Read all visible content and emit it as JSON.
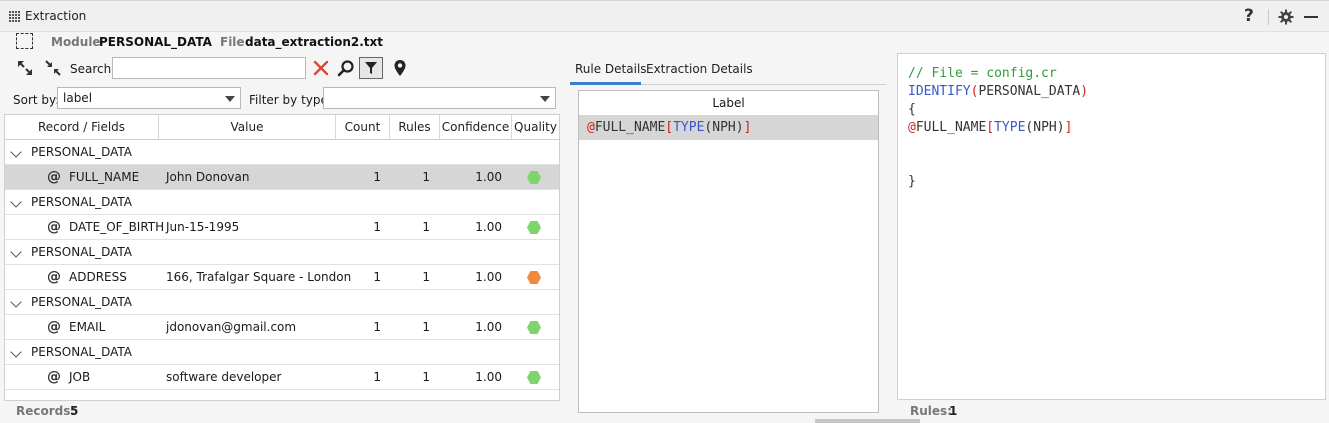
{
  "window": {
    "title": "Extraction",
    "help_glyph": "?"
  },
  "module_bar": {
    "module_label": "Module",
    "module_value": "PERSONAL_DATA",
    "file_label": "File",
    "file_value": "data_extraction2.txt"
  },
  "toolbar": {
    "search_label": "Search:",
    "search_value": ""
  },
  "sort": {
    "label": "Sort by:",
    "value": "label"
  },
  "filter": {
    "label": "Filter by type:",
    "value": ""
  },
  "table": {
    "columns": [
      "Record / Fields",
      "Value",
      "Count",
      "Rules",
      "Confidence",
      "Quality"
    ],
    "groups": [
      {
        "record": "PERSONAL_DATA",
        "field": "FULL_NAME",
        "value": "John Donovan",
        "count": "1",
        "rules": "1",
        "confidence": "1.00",
        "quality_color": "#7ed66b",
        "selected": true
      },
      {
        "record": "PERSONAL_DATA",
        "field": "DATE_OF_BIRTH",
        "value": "Jun-15-1995",
        "count": "1",
        "rules": "1",
        "confidence": "1.00",
        "quality_color": "#7ed66b",
        "selected": false
      },
      {
        "record": "PERSONAL_DATA",
        "field": "ADDRESS",
        "value": "166, Trafalgar Square - London",
        "count": "1",
        "rules": "1",
        "confidence": "1.00",
        "quality_color": "#f0883e",
        "selected": false
      },
      {
        "record": "PERSONAL_DATA",
        "field": "EMAIL",
        "value": "jdonovan@gmail.com",
        "count": "1",
        "rules": "1",
        "confidence": "1.00",
        "quality_color": "#7ed66b",
        "selected": false
      },
      {
        "record": "PERSONAL_DATA",
        "field": "JOB",
        "value": "software developer",
        "count": "1",
        "rules": "1",
        "confidence": "1.00",
        "quality_color": "#7ed66b",
        "selected": false
      }
    ],
    "field_prefix": "@"
  },
  "records_status": {
    "label": "Records:",
    "value": "5"
  },
  "details": {
    "tabs": [
      "Rule Details",
      "Extraction Details"
    ],
    "active_tab": "Rule Details",
    "label_header": "Label",
    "rule": {
      "at": "@",
      "name": "FULL_NAME",
      "open": "[",
      "type": "TYPE",
      "arg": "(NPH)",
      "close": "]"
    }
  },
  "code": {
    "line1": "// File = config.cr",
    "line2_kw": "IDENTIFY",
    "line2_open": "(",
    "line2_arg": "PERSONAL_DATA",
    "line2_close": ")",
    "line3": "{",
    "line4_at": "@",
    "line4_name": "FULL_NAME",
    "line4_open": "[",
    "line4_type": "TYPE",
    "line4_arg": "(NPH)",
    "line4_close": "]",
    "line5": "}"
  },
  "rules_status": {
    "label": "Rules:",
    "value": "1"
  },
  "colors": {
    "accent": "#3d7cc9",
    "quality_good": "#7ed66b",
    "quality_warn": "#f0883e",
    "selected_row": "#d6d6d6"
  },
  "icons": [
    "grid-grip-icon",
    "help-icon",
    "gear-icon",
    "minimize-icon",
    "module-select-icon",
    "expand-all-icon",
    "collapse-all-icon",
    "clear-icon",
    "search-icon",
    "filter-icon",
    "location-pin-icon"
  ]
}
